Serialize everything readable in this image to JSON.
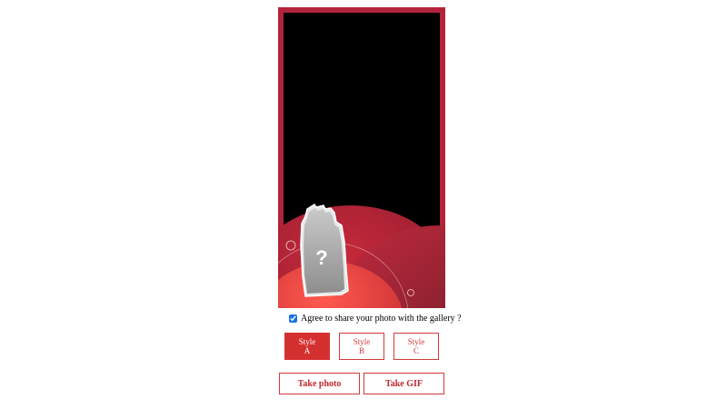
{
  "consent": {
    "label": "Agree to share your photo with the gallery ?",
    "checked": true
  },
  "styles": [
    {
      "line1": "Style",
      "line2": "A",
      "selected": true
    },
    {
      "line1": "Style",
      "line2": "B",
      "selected": false
    },
    {
      "line1": "Style",
      "line2": "C",
      "selected": false
    }
  ],
  "actions": {
    "take_photo": "Take photo",
    "take_gif": "Take GIF"
  },
  "frame": {
    "placeholder_glyph": "?",
    "colors": {
      "border": "#b3233a",
      "accent": "#d4302f"
    }
  }
}
